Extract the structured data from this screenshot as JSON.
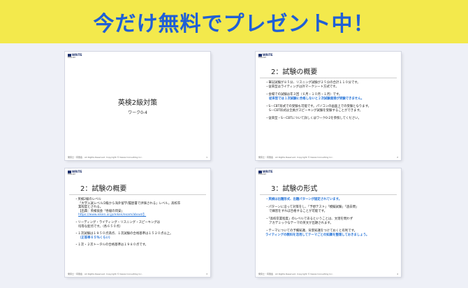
{
  "banner": {
    "text": "今だけ無料でプレゼント中！",
    "bg_color": "#f3e94c",
    "text_color": "#1f5fd6"
  },
  "logo": {
    "name": "WRITE",
    "sub": "ENGLISH"
  },
  "footer": {
    "left": "発音士・有限会",
    "copyright": "All Rights Reserved. Copyright © Kawai Consulting Inc."
  },
  "slides": [
    {
      "title": "英検2級対策",
      "subtitle": "ワーク0-4",
      "page": "1"
    },
    {
      "title": "2：試験の概要",
      "page": "2",
      "lines": [
        "・筆記試験が８５分、リスニング試験が２５分の合計１１０分です。",
        "・従来型はライティングは外マークシート方式です。",
        "・会場での試験は年３回（６月・１０月・１月）です。",
        "従来型では１次試験に合格しないと２次試験面接が受験できません。",
        "・S－CBT形式での受験も可能です。パソコンの画面上での受験となります。",
        "S－CBT形式は全員がスピーキング試験を受験することができます。",
        "・従来型・S－CBTについて詳しくはワーク0-2を参照してください。"
      ]
    },
    {
      "title": "2：試験の概要",
      "page": "3",
      "lines": [
        "・英検2級のレベル",
        "「大学入試レベル/2級から海外留学/履歴書で評価される」レベル。高校卒",
        "業程度とされる。",
        "【出典：英検協会「各級の目安」",
        "https://www.eiken.or.jp/eiken/exam/about/】",
        "・リーディング・ライティング・リスニング・スピーキングは",
        "均等な配点です。（各６５０点）",
        "・１次試験は１９５０点満点、１次試験の合格基準は１５２０点以上。",
        "（正答率６５％くらい）",
        "・１次・２次トータルの合格基準は１９８０点です。"
      ]
    },
    {
      "title": "3：試験の形式",
      "page": "4",
      "lines": [
        "・英検は出題形式、出題パターンが固定されています。",
        "・パターンに沿って対策をし、「予想テスト」「模擬試験」「過去問」",
        "で練習をすれば合格することが可能です。",
        "・「高校卒業程度」のレベルであるということは、文理を問わず",
        "アカデミックなテーマの英文が出題されます。",
        "・テーマについての予備知識、背景知識をつけておくと有利です。",
        "ライティングの教科を活用してテーマごとの知識を整理しておきましょう。"
      ]
    }
  ]
}
